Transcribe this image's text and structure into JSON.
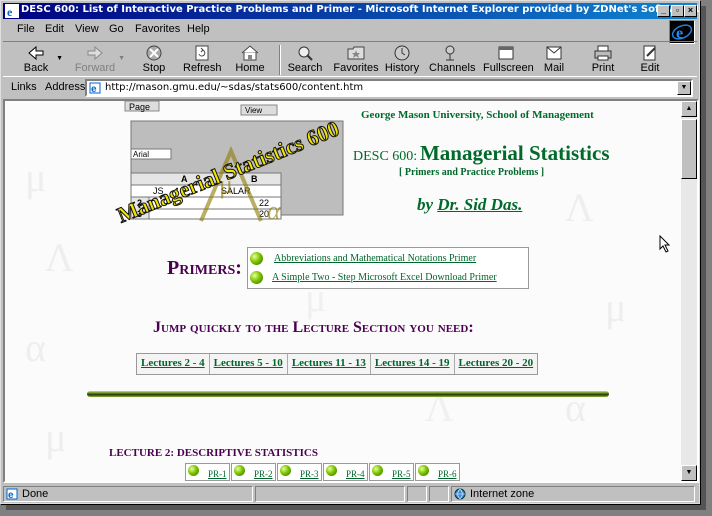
{
  "window": {
    "title": "DESC 600: List of Interactive Practice Problems and Primer - Microsoft Internet Explorer provided by ZDNet's Software Library"
  },
  "menu": [
    {
      "label": "File"
    },
    {
      "label": "Edit"
    },
    {
      "label": "View"
    },
    {
      "label": "Go"
    },
    {
      "label": "Favorites"
    },
    {
      "label": "Help"
    }
  ],
  "toolbar": {
    "back": "Back",
    "forward": "Forward",
    "stop": "Stop",
    "refresh": "Refresh",
    "home": "Home",
    "search": "Search",
    "favorites": "Favorites",
    "history": "History",
    "channels": "Channels",
    "fullscreen": "Fullscreen",
    "mail": "Mail",
    "print": "Print",
    "edit": "Edit"
  },
  "address": {
    "links_label": "Links",
    "address_label": "Address",
    "url": "http://mason.gmu.edu/~sdas/stats600/content.htm"
  },
  "page": {
    "logo_text": "Managerial Statistics 600",
    "school": "George Mason University, School of Management",
    "course_code": "DESC 600:",
    "course_name": "Managerial Statistics",
    "subtitle": "[ Primers and Practice Problems ]",
    "by": "by",
    "author": "Dr. Sid Das.",
    "primers_heading": "Primers:",
    "primers": [
      {
        "label": "Abbreviations and Mathematical Notations Primer"
      },
      {
        "label": "A Simple Two - Step Microsoft Excel Download Primer"
      }
    ],
    "jump_heading": "Jump quickly to the Lecture Section you need:",
    "lectures": [
      {
        "label": "Lectures 2 - 4"
      },
      {
        "label": "Lectures 5 - 10"
      },
      {
        "label": "Lectures 11 - 13"
      },
      {
        "label": "Lectures 14 - 19"
      },
      {
        "label": "Lectures 20 - 20"
      }
    ],
    "lecture2_heading": "LECTURE 2:   DESCRIPTIVE STATISTICS",
    "practice_problems": [
      {
        "label": "PR-1"
      },
      {
        "label": "PR-2"
      },
      {
        "label": "PR-3"
      },
      {
        "label": "PR-4"
      },
      {
        "label": "PR-5"
      },
      {
        "label": "PR-6"
      }
    ],
    "logo_spreadsheet": {
      "tab": "Page",
      "menu": "View",
      "font": "Arial",
      "col_a": "A",
      "col_b": "B",
      "cell_js": "JS",
      "cell_salar": "SALAR",
      "row2": "2",
      "row3": "3",
      "val1": "22",
      "val2": "20"
    }
  },
  "status": {
    "text": "Done",
    "zone": "Internet zone"
  },
  "colors": {
    "title_start": "#000080",
    "link_green": "#00662b",
    "heading_purple": "#4b0050"
  }
}
